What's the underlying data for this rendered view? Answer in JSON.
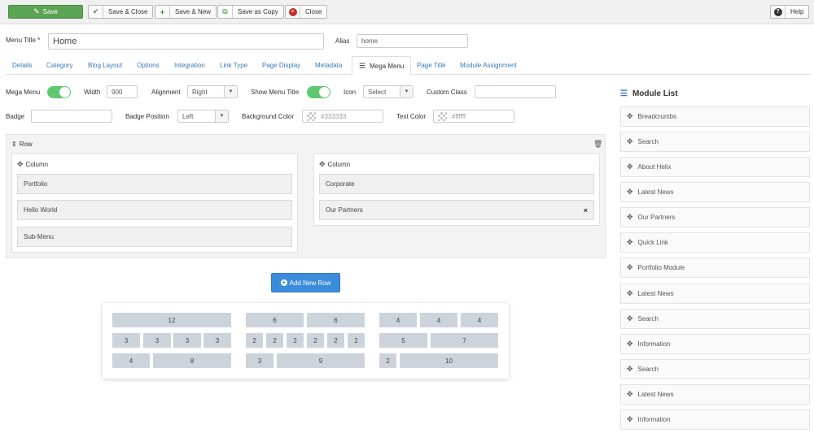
{
  "toolbar": {
    "save": "Save",
    "save_close": "Save & Close",
    "save_new": "Save & New",
    "save_copy": "Save as Copy",
    "close": "Close",
    "help": "Help"
  },
  "form": {
    "menu_title_label": "Menu Title *",
    "menu_title_value": "Home",
    "alias_label": "Alias",
    "alias_value": "home"
  },
  "tabs": [
    "Details",
    "Category",
    "Blog Layout",
    "Options",
    "Integration",
    "Link Type",
    "Page Display",
    "Metadata",
    "Mega Menu",
    "Page Title",
    "Module Assignment"
  ],
  "megamenu": {
    "mega_menu_label": "Mega Menu",
    "width_label": "Width",
    "width_value": "900",
    "alignment_label": "Alignment",
    "alignment_value": "Right",
    "show_title_label": "Show Menu Title",
    "icon_label": "Icon",
    "icon_value": "Select",
    "custom_class_label": "Custom Class",
    "custom_class_value": "",
    "badge_label": "Badge",
    "badge_value": "",
    "badge_position_label": "Badge Position",
    "badge_position_value": "Left",
    "bg_color_label": "Background Color",
    "bg_color_placeholder": "#333333",
    "text_color_label": "Text Color",
    "text_color_placeholder": "#ffffff"
  },
  "row": {
    "label": "Row",
    "column_label": "Column",
    "col1_items": [
      "Portfolio",
      "Hello World",
      "Sub-Menu"
    ],
    "col2_items": [
      "Corporate",
      "Our Partners"
    ]
  },
  "add_row": "Add New Row",
  "layouts": {
    "a": [
      [
        "12"
      ],
      [
        "3",
        "3",
        "3",
        "3"
      ],
      [
        "4",
        "8"
      ]
    ],
    "b": [
      [
        "6",
        "6"
      ],
      [
        "2",
        "2",
        "2",
        "2",
        "2",
        "2"
      ],
      [
        "3",
        "9"
      ]
    ],
    "c": [
      [
        "4",
        "4",
        "4"
      ],
      [
        "5",
        "7"
      ],
      [
        "2",
        "10"
      ]
    ]
  },
  "module_list": {
    "title": "Module List",
    "items": [
      "Breadcrumbs",
      "Search",
      "About Helix",
      "Latest News",
      "Our Partners",
      "Quick Link",
      "Portfolio Module",
      "Latest News",
      "Search",
      "Information",
      "Search",
      "Latest News",
      "Information"
    ]
  },
  "colors": {
    "save": "#5aa554",
    "primary": "#3b8ddc",
    "toggle": "#5ec96f",
    "link": "#3b78b7"
  }
}
